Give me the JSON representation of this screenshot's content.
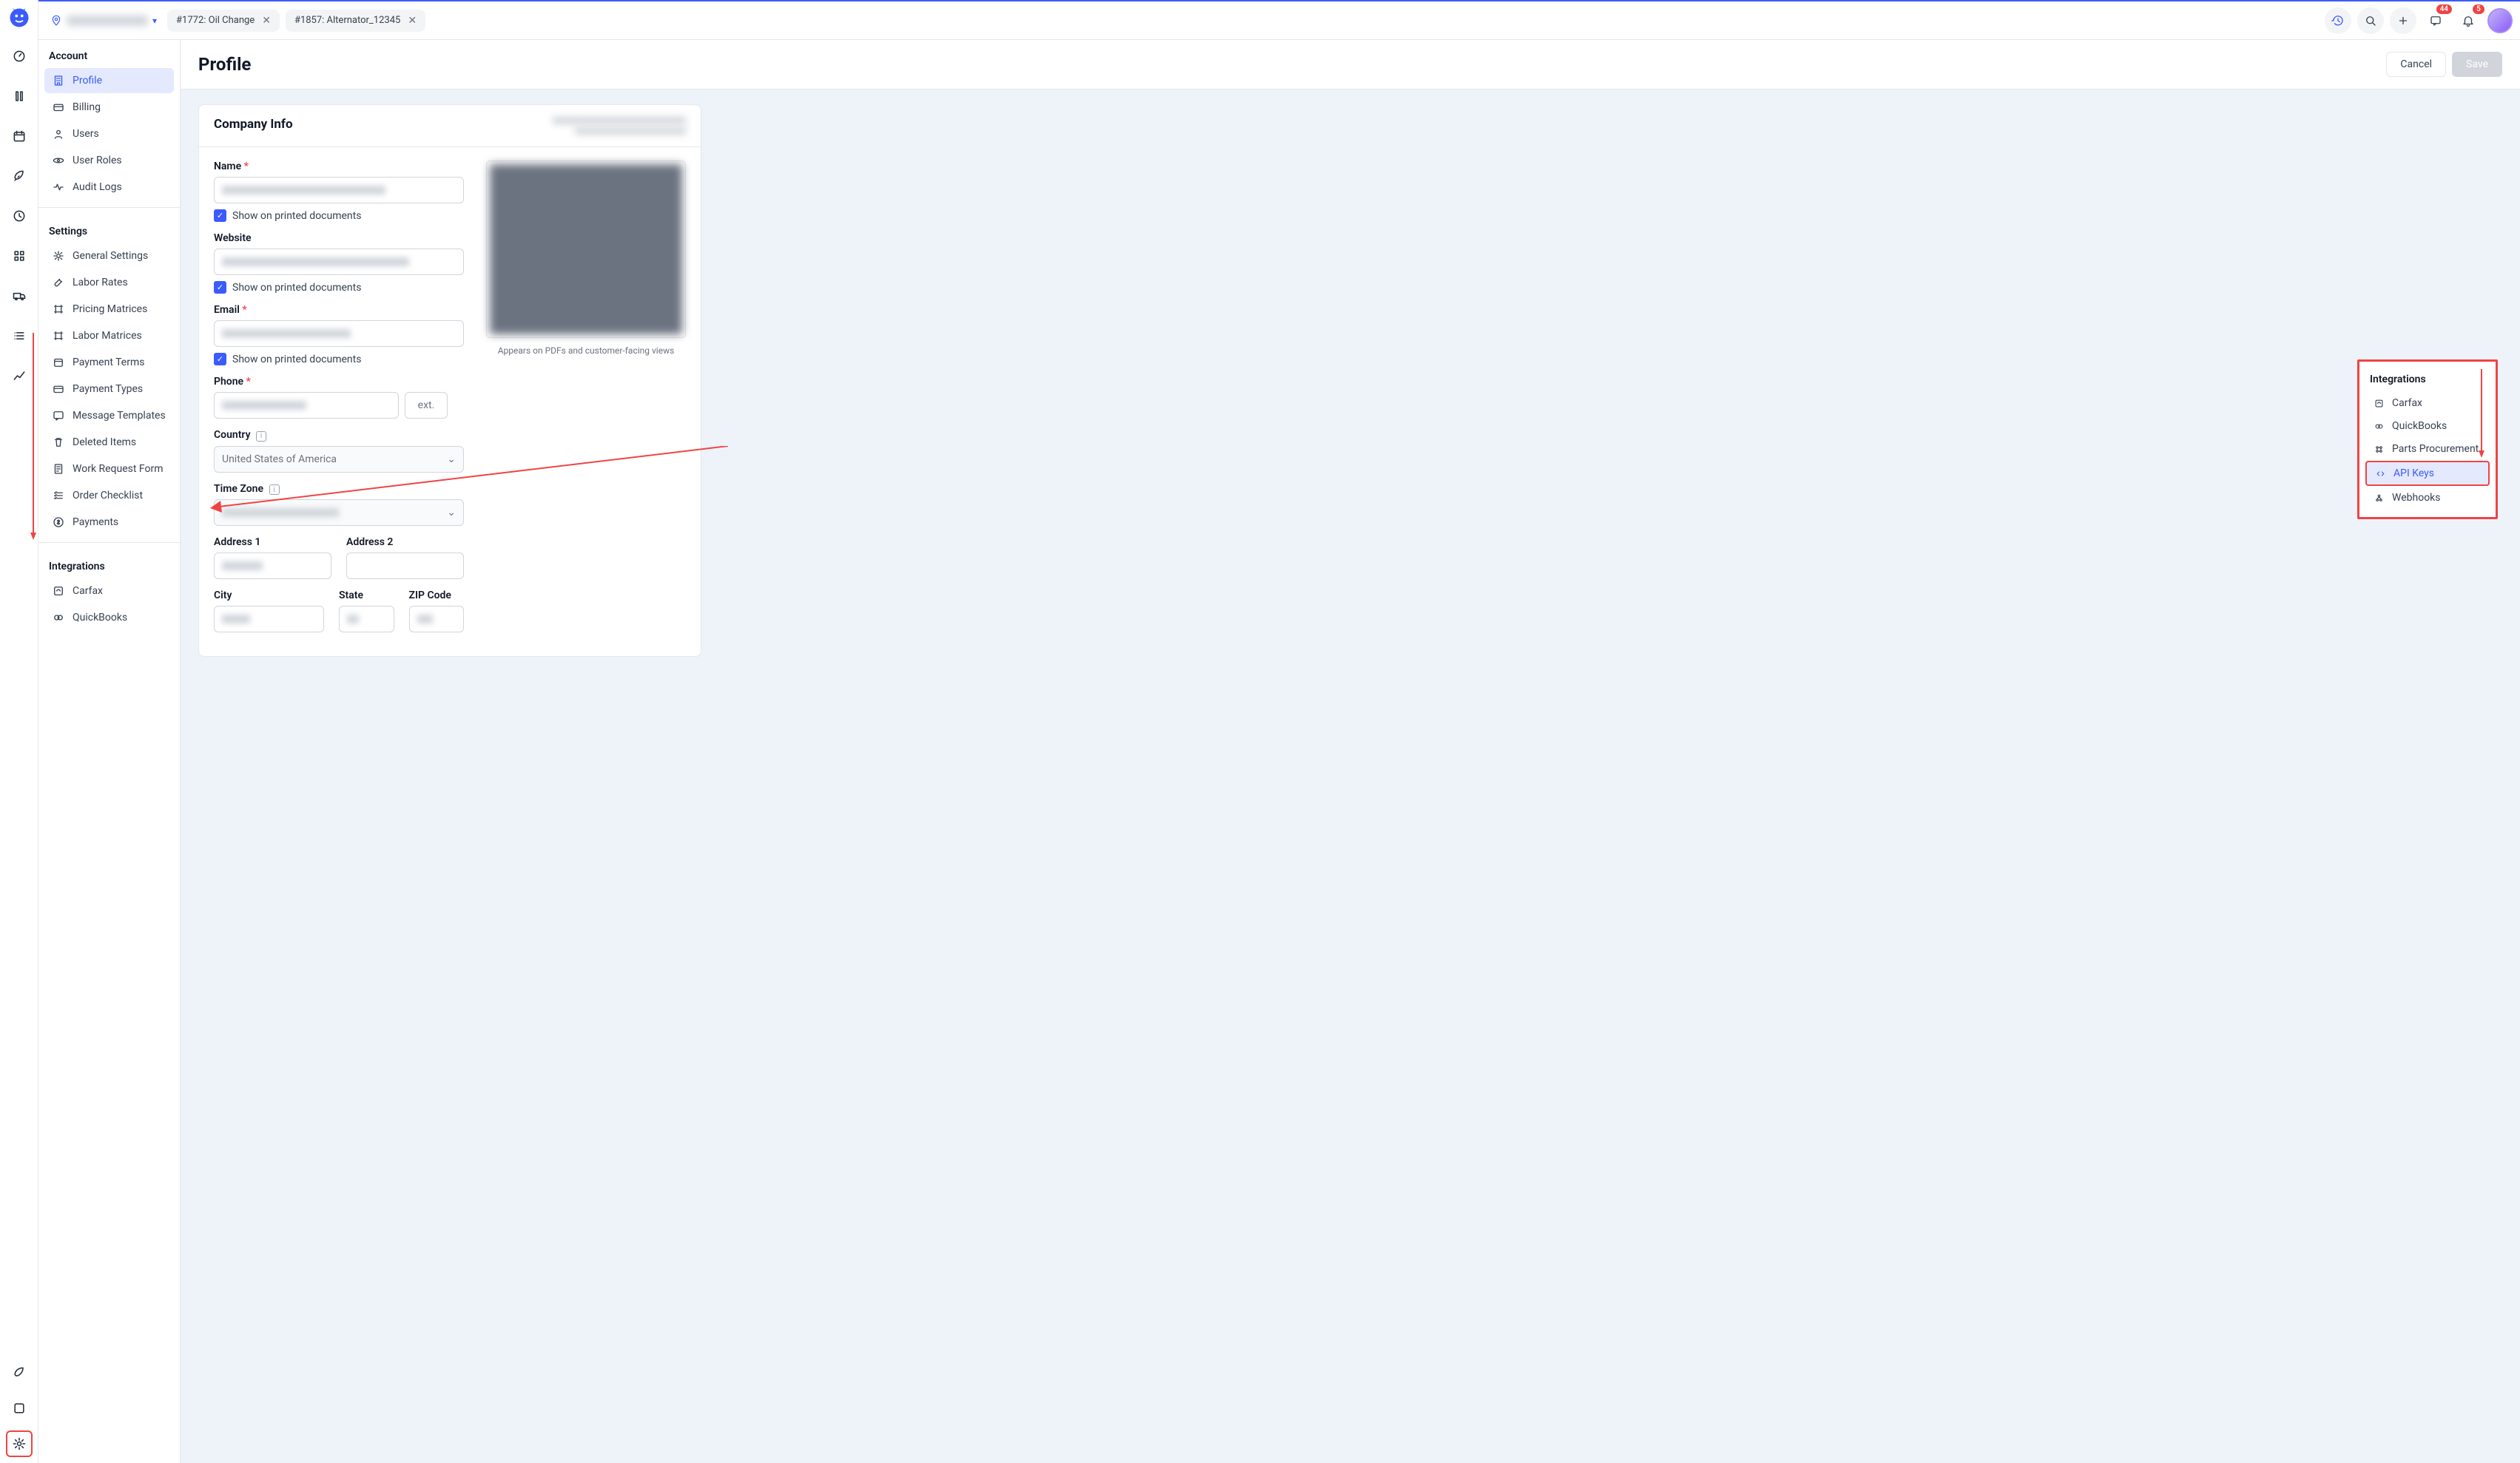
{
  "topbar": {
    "tabs": [
      {
        "label": "#1772: Oil Change"
      },
      {
        "label": "#1857: Alternator_12345"
      }
    ],
    "badges": {
      "chat": "44",
      "bell": "5"
    }
  },
  "sidebar": {
    "account_header": "Account",
    "account_items": [
      {
        "name": "profile",
        "label": "Profile",
        "active": true
      },
      {
        "name": "billing",
        "label": "Billing"
      },
      {
        "name": "users",
        "label": "Users"
      },
      {
        "name": "user-roles",
        "label": "User Roles"
      },
      {
        "name": "audit-logs",
        "label": "Audit Logs"
      }
    ],
    "settings_header": "Settings",
    "settings_items": [
      {
        "name": "general-settings",
        "label": "General Settings"
      },
      {
        "name": "labor-rates",
        "label": "Labor Rates"
      },
      {
        "name": "pricing-matrices",
        "label": "Pricing Matrices"
      },
      {
        "name": "labor-matrices",
        "label": "Labor Matrices"
      },
      {
        "name": "payment-terms",
        "label": "Payment Terms"
      },
      {
        "name": "payment-types",
        "label": "Payment Types"
      },
      {
        "name": "message-templates",
        "label": "Message Templates"
      },
      {
        "name": "deleted-items",
        "label": "Deleted Items"
      },
      {
        "name": "work-request-form",
        "label": "Work Request Form"
      },
      {
        "name": "order-checklist",
        "label": "Order Checklist"
      },
      {
        "name": "payments",
        "label": "Payments"
      }
    ],
    "integrations_header": "Integrations",
    "integrations_items": [
      {
        "name": "carfax",
        "label": "Carfax"
      },
      {
        "name": "quickbooks",
        "label": "QuickBooks"
      }
    ]
  },
  "page": {
    "title": "Profile",
    "cancel": "Cancel",
    "save": "Save"
  },
  "company": {
    "heading": "Company Info",
    "name_label": "Name",
    "show_printed": "Show on printed documents",
    "website_label": "Website",
    "email_label": "Email",
    "phone_label": "Phone",
    "ext": "ext.",
    "country_label": "Country",
    "country_value": "United States of America",
    "tz_label": "Time Zone",
    "addr1_label": "Address 1",
    "addr2_label": "Address 2",
    "city_label": "City",
    "state_label": "State",
    "zip_label": "ZIP Code",
    "img_caption": "Appears on PDFs and customer-facing views"
  },
  "callout": {
    "header": "Integrations",
    "items": [
      {
        "name": "carfax",
        "label": "Carfax"
      },
      {
        "name": "quickbooks",
        "label": "QuickBooks"
      },
      {
        "name": "parts-procurement",
        "label": "Parts Procurement"
      },
      {
        "name": "api-keys",
        "label": "API Keys",
        "highlight": true
      },
      {
        "name": "webhooks",
        "label": "Webhooks"
      }
    ]
  }
}
